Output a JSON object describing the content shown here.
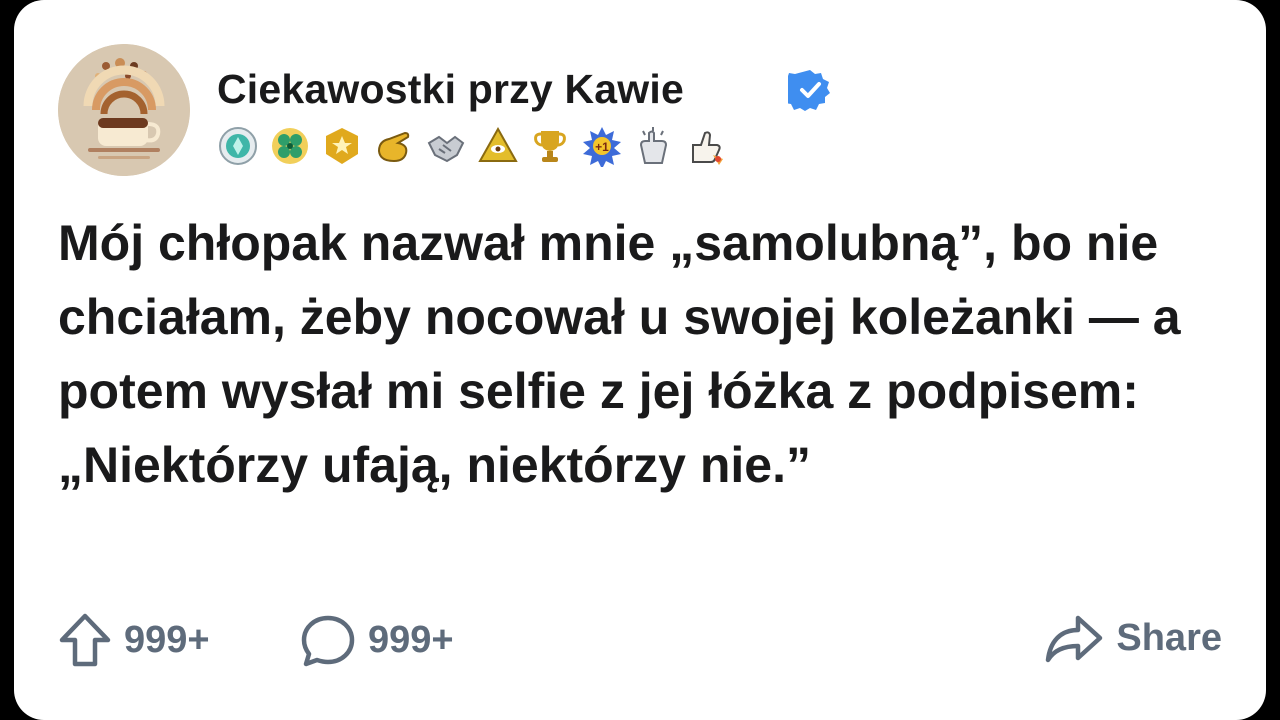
{
  "post": {
    "channel_name": "Ciekawostki przy Kawie",
    "verified": true,
    "body": "Mój chłopak nazwał mnie „samolubną”, bo nie chciałam, żeby nocował u swojej koleżanki — a potem wysłał mi selfie z jej łóżka z podpisem: „Niektórzy ufają, niektórzy nie.”"
  },
  "badges": [
    {
      "icon": "teal-gem-badge-icon",
      "color": "#3fb6a8"
    },
    {
      "icon": "green-clover-badge-icon",
      "color": "#2e9e6a"
    },
    {
      "icon": "gold-star-badge-icon",
      "color": "#e0a91d"
    },
    {
      "icon": "gold-pointing-hand-icon",
      "color": "#e8b52a"
    },
    {
      "icon": "handshake-icon",
      "color": "#8a8f98"
    },
    {
      "icon": "gold-pyramid-eye-icon",
      "color": "#e3bd2b"
    },
    {
      "icon": "gold-trophy-icon",
      "color": "#d8a520"
    },
    {
      "icon": "plus-one-starburst-icon",
      "color": "#3d6bd8"
    },
    {
      "icon": "clapping-hands-icon",
      "color": "#9aa0a8"
    },
    {
      "icon": "thumbs-up-rocket-icon",
      "color": "#f2a33a"
    }
  ],
  "actions": {
    "upvotes": "999+",
    "comments": "999+",
    "share_label": "Share"
  },
  "colors": {
    "verified_blue": "#3f8ef0",
    "action_gray": "#5e6b7b",
    "text": "#1a1a1b"
  }
}
